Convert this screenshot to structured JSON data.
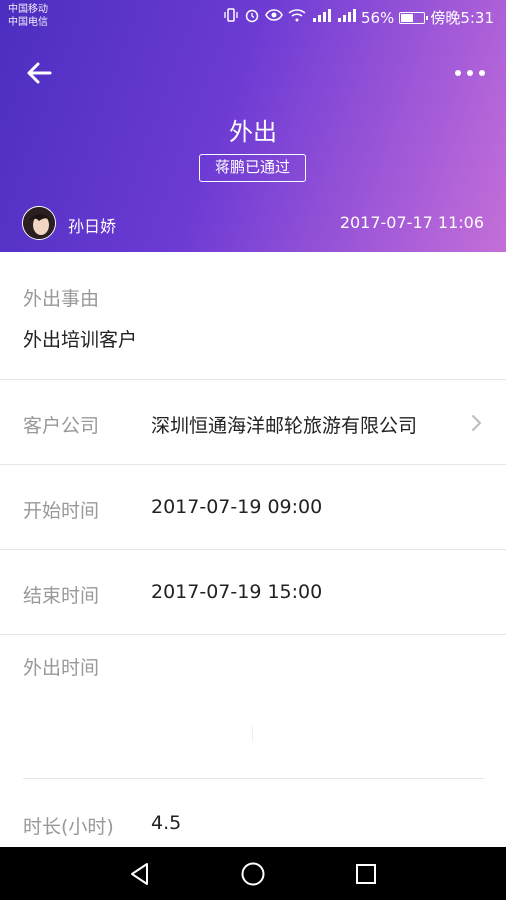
{
  "status_bar": {
    "carrier1": "中国移动",
    "carrier2": "中国电信",
    "battery": "56%",
    "battery_level": 0.56,
    "time": "傍晚5:31",
    "icons": [
      "vibrate-icon",
      "alarm-icon",
      "eye-icon",
      "wifi-icon",
      "signal-icon",
      "signal-icon",
      "battery-icon"
    ]
  },
  "header": {
    "title": "外出",
    "approval_badge": "蒋鹏已通过",
    "user_name": "孙日娇",
    "created_time": "2017-07-17 11:06",
    "gradient": [
      "#4b2ec0",
      "#c46fd8"
    ]
  },
  "reason": {
    "label": "外出事由",
    "value": "外出培训客户"
  },
  "rows": [
    {
      "label": "客户公司",
      "value": "深圳恒通海洋邮轮旅游有限公司"
    },
    {
      "label": "开始时间",
      "value": "2017-07-19 09:00"
    },
    {
      "label": "结束时间",
      "value": "2017-07-19 15:00"
    }
  ],
  "outing_time": {
    "label": "外出时间"
  },
  "duration": {
    "label": "时长(小时)",
    "value": "4.5"
  }
}
